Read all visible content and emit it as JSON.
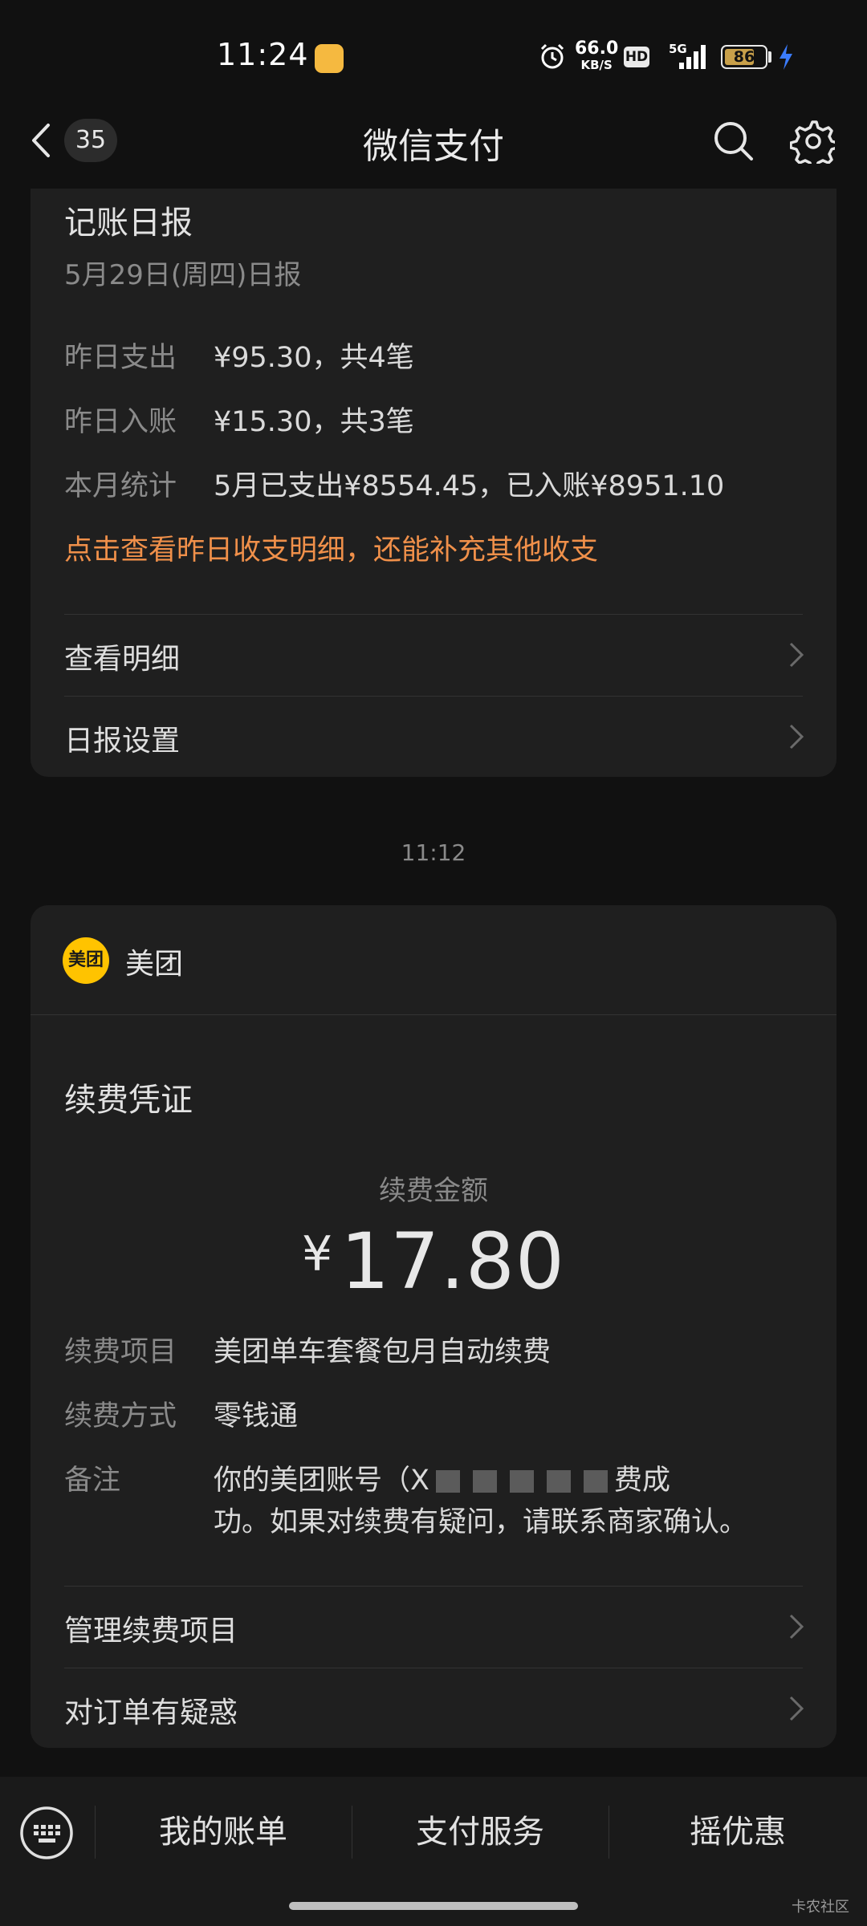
{
  "status_bar": {
    "time": "11:24",
    "net_speed": "66.0",
    "net_speed_unit": "KB/S",
    "hd_label": "HD",
    "signal_label": "5G",
    "battery": "86"
  },
  "nav": {
    "unread_count": "35",
    "title": "微信支付"
  },
  "daily_report": {
    "title": "记账日报",
    "subtitle": "5月29日(周四)日报",
    "rows": [
      {
        "label": "昨日支出",
        "value": "¥95.30，共4笔"
      },
      {
        "label": "昨日入账",
        "value": "¥15.30，共3笔"
      },
      {
        "label": "本月统计",
        "value": "5月已支出¥8554.45，已入账¥8951.10"
      }
    ],
    "highlight": "点击查看昨日收支明细，还能补充其他收支",
    "links": [
      "查看明细",
      "日报设置"
    ]
  },
  "timestamp": "11:12",
  "receipt": {
    "merchant_logo_text": "美团",
    "merchant_name": "美团",
    "title": "续费凭证",
    "amount_label": "续费金额",
    "currency": "¥",
    "amount": "17.80",
    "rows": [
      {
        "label": "续费项目",
        "value": "美团单车套餐包月自动续费"
      },
      {
        "label": "续费方式",
        "value": "零钱通"
      }
    ],
    "remark_label": "备注",
    "remark_line1_start": "你的美团账号（X",
    "remark_line1_end": "费成",
    "remark_line2": "功。如果对续费有疑问，请联系商家确认。",
    "links": [
      "管理续费项目",
      "对订单有疑惑"
    ]
  },
  "bottom_tabs": [
    "我的账单",
    "支付服务",
    "摇优惠"
  ],
  "watermark": "卡农社区",
  "colors": {
    "background": "#111111",
    "card": "#1f1f1f",
    "highlight_orange": "#f0904a",
    "meituan_yellow": "#ffc300"
  }
}
